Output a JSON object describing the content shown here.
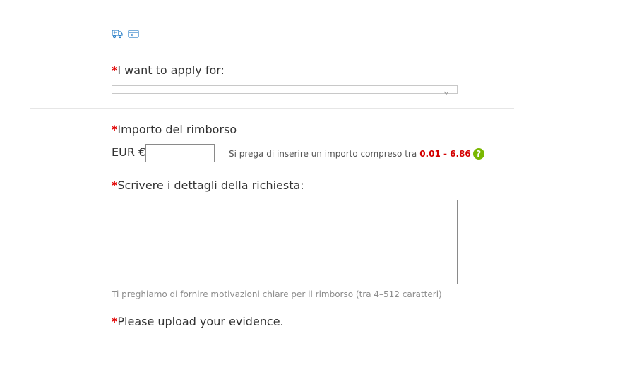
{
  "icons": {
    "first": "truck-return-icon",
    "second": "card-return-icon",
    "color": "#2b7fc7"
  },
  "apply": {
    "required_mark": "*",
    "label": "I want to apply for:",
    "selected_value": ""
  },
  "amount": {
    "required_mark": "*",
    "label": "Importo del rimborso",
    "currency": "EUR €",
    "value": "",
    "hint": "Si prega di inserire un importo compreso tra",
    "range": "0.01 - 6.86",
    "help": "?"
  },
  "details": {
    "required_mark": "*",
    "label": "Scrivere i dettagli della richiesta:",
    "value": "",
    "hint": "Ti preghiamo di fornire motivazioni chiare per il rimborso (tra 4–512 caratteri)"
  },
  "evidence": {
    "required_mark": "*",
    "label": "Please upload your evidence."
  },
  "colors": {
    "required": "#e10000",
    "range": "#d40000",
    "help_bg": "#7ab800"
  }
}
